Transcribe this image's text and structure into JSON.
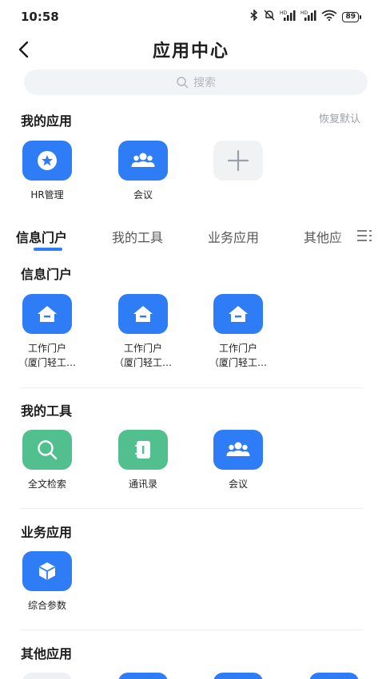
{
  "status_bar": {
    "time": "10:58",
    "battery": "89",
    "hd1": "HD",
    "hd2": "HD"
  },
  "nav": {
    "title": "应用中心"
  },
  "search": {
    "placeholder": "搜索"
  },
  "my_apps": {
    "title": "我的应用",
    "reset_label": "恢复默认",
    "items": [
      {
        "label": "HR管理",
        "icon": "star-badge-icon"
      },
      {
        "label": "会议",
        "icon": "people-group-icon"
      },
      {
        "label": "",
        "icon": "plus-icon"
      }
    ]
  },
  "tabs": [
    {
      "label": "信息门户",
      "active": true
    },
    {
      "label": "我的工具",
      "active": false
    },
    {
      "label": "业务应用",
      "active": false
    },
    {
      "label": "其他应",
      "active": false
    }
  ],
  "sections": [
    {
      "title": "信息门户",
      "items": [
        {
          "label_line1": "工作门户",
          "label_line2": "（厦门轻工…",
          "icon": "home-icon"
        },
        {
          "label_line1": "工作门户",
          "label_line2": "（厦门轻工…",
          "icon": "home-icon"
        },
        {
          "label_line1": "工作门户",
          "label_line2": "（厦门轻工…",
          "icon": "home-icon"
        }
      ]
    },
    {
      "title": "我的工具",
      "items": [
        {
          "label": "全文检索",
          "icon": "search-icon"
        },
        {
          "label": "通讯录",
          "icon": "contacts-book-icon"
        },
        {
          "label": "会议",
          "icon": "people-group-icon"
        }
      ]
    },
    {
      "title": "业务应用",
      "items": [
        {
          "label": "综合参数",
          "icon": "cube-icon"
        }
      ]
    },
    {
      "title": "其他应用",
      "items": []
    }
  ],
  "colors": {
    "accent": "#2f7df6",
    "green": "#52c08e",
    "muted": "#9aa0a8"
  }
}
